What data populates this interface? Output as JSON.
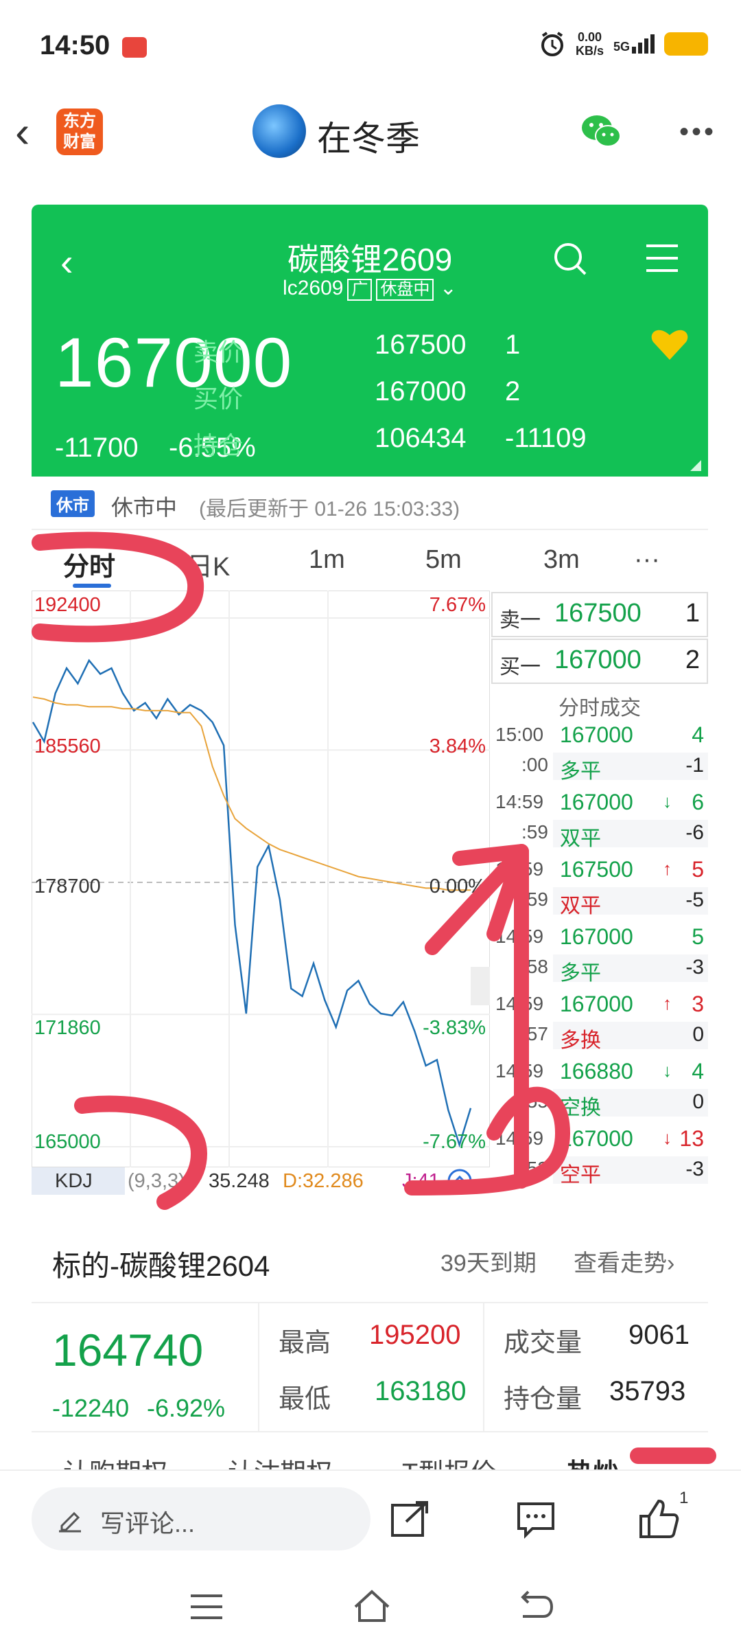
{
  "status_bar": {
    "time": "14:50",
    "net_speed": "0.00",
    "net_unit": "KB/s",
    "signal": "5G"
  },
  "nav": {
    "logo_text_1": "东方",
    "logo_text_2": "财富",
    "title": "在冬季"
  },
  "quote": {
    "title": "碳酸锂2609",
    "code": "lc2609",
    "exchange_tag": "广",
    "status_tag": "休盘中",
    "price": "167000",
    "change": "-11700",
    "change_pct": "-6.55%",
    "sell_label": "卖价",
    "sell_price": "167500",
    "sell_qty": "1",
    "buy_label": "买价",
    "buy_price": "167000",
    "buy_qty": "2",
    "oi_label": "持仓",
    "oi": "106434",
    "oi_change": "-11109",
    "colors": {
      "bg": "#12c155"
    }
  },
  "market_status": {
    "badge": "休市",
    "text": "休市中",
    "updated": "(最后更新于 01-26 15:03:33)"
  },
  "tabs": [
    "分时",
    "日K",
    "1m",
    "5m",
    "3m",
    "···"
  ],
  "chart_data": {
    "type": "line",
    "y_left_labels": [
      "192400",
      "185560",
      "178700",
      "171860",
      "165000"
    ],
    "y_right_labels": [
      "7.67%",
      "3.84%",
      "0.00%",
      "-3.83%",
      "-7.67%"
    ],
    "ylim": [
      165000,
      192400
    ],
    "series": [
      {
        "name": "price",
        "color": "#1f6fb4",
        "values": [
          187000,
          186000,
          188500,
          189800,
          189000,
          190200,
          189500,
          189800,
          188500,
          187600,
          188000,
          187200,
          188200,
          187400,
          187900,
          187600,
          187000,
          185800,
          176500,
          171900,
          179500,
          180600,
          177800,
          173200,
          172800,
          174500,
          172600,
          171200,
          173100,
          173600,
          172400,
          171900,
          171800,
          172500,
          171000,
          169200,
          169500,
          166900,
          165100,
          167000
        ]
      },
      {
        "color": "#e8a33a",
        "values": [
          188300,
          188200,
          188000,
          187900,
          187900,
          187800,
          187800,
          187800,
          187700,
          187700,
          187600,
          187600,
          187600,
          187500,
          187500,
          186800,
          184700,
          183200,
          182000,
          181500,
          181100,
          180700,
          180400,
          180200,
          180000,
          179800,
          179600,
          179400,
          179200,
          179000,
          178900,
          178800,
          178700,
          178600,
          178500,
          178400,
          178400,
          178300,
          178300,
          178300
        ]
      }
    ]
  },
  "kdj": {
    "label": "KDJ",
    "params": "(9,3,3)",
    "k": "35.248",
    "d": "D:32.286",
    "j": "J:41"
  },
  "order_book": [
    {
      "label": "卖一",
      "price": "167500",
      "qty": "1"
    },
    {
      "label": "买一",
      "price": "167000",
      "qty": "2"
    }
  ],
  "ticks_title": "分时成交",
  "ticks": [
    {
      "time": "15:00",
      "sec": ":00",
      "price": "167000",
      "arrow": "",
      "qty": "4",
      "type": "多平",
      "oi": "-1",
      "price_color": "#13a14a",
      "qty_color": "#13a14a",
      "type_color": "#13a14a"
    },
    {
      "time": "14:59",
      "sec": ":59",
      "price": "167000",
      "arrow": "↓",
      "qty": "6",
      "type": "双平",
      "oi": "-6",
      "price_color": "#13a14a",
      "qty_color": "#13a14a",
      "type_color": "#13a14a"
    },
    {
      "time": "14:59",
      "sec": ":59",
      "price": "167500",
      "arrow": "↑",
      "qty": "5",
      "type": "双平",
      "oi": "-5",
      "price_color": "#13a14a",
      "qty_color": "#d8232a",
      "type_color": "#d8232a"
    },
    {
      "time": "14:59",
      "sec": ":58",
      "price": "167000",
      "arrow": "",
      "qty": "5",
      "type": "多平",
      "oi": "-3",
      "price_color": "#13a14a",
      "qty_color": "#13a14a",
      "type_color": "#13a14a"
    },
    {
      "time": "14:59",
      "sec": ":57",
      "price": "167000",
      "arrow": "↑",
      "qty": "3",
      "type": "多换",
      "oi": "0",
      "price_color": "#13a14a",
      "qty_color": "#d8232a",
      "type_color": "#d8232a"
    },
    {
      "time": "14:59",
      "sec": ":55",
      "price": "166880",
      "arrow": "↓",
      "qty": "4",
      "type": "空换",
      "oi": "0",
      "price_color": "#13a14a",
      "qty_color": "#13a14a",
      "type_color": "#13a14a"
    },
    {
      "time": "14:59",
      "sec": ":53",
      "price": "167000",
      "arrow": "↓",
      "qty": "13",
      "type": "空平",
      "oi": "-3",
      "price_color": "#13a14a",
      "qty_color": "#d8232a",
      "type_color": "#d8232a"
    }
  ],
  "underlying": {
    "title": "标的-碳酸锂2604",
    "days": "39天到期",
    "link": "查看走势",
    "price": "164740",
    "change": "-12240",
    "change_pct": "-6.92%",
    "high_label": "最高",
    "high": "195200",
    "low_label": "最低",
    "low": "163180",
    "vol_label": "成交量",
    "vol": "9061",
    "oi_label": "持仓量",
    "oi": "35793"
  },
  "sub_tabs": [
    "认购期权",
    "认沽期权",
    "T型报价",
    "热炒"
  ],
  "comment": {
    "placeholder": "写评论...",
    "like_count": "1"
  },
  "colors": {
    "up": "#d8232a",
    "down": "#13a14a",
    "accent": "#2a6fd8"
  }
}
